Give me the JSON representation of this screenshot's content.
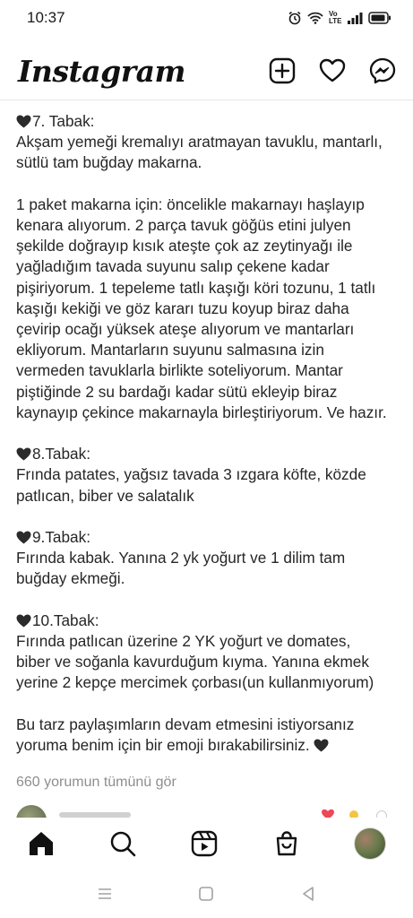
{
  "status": {
    "time": "10:37",
    "network_label": "Vo LTE"
  },
  "app": {
    "logo": "Instagram"
  },
  "caption": {
    "intro_lines": [
      "7. Tabak:",
      "Akşam yemeği kremalıyı aratmayan tavuklu, mantarlı,",
      "sütlü tam buğday makarna."
    ],
    "recipe_lines": [
      "1 paket makarna için: öncelikle makarnayı haşlayıp",
      "kenara alıyorum. 2 parça tavuk göğüs etini julyen",
      "şekilde doğrayıp kısık ateşte çok az zeytinyağı ile",
      "yağladığım tavada suyunu salıp çekene kadar",
      "pişiriyorum. 1 tepeleme tatlı kaşığı köri tozunu, 1 tatlı",
      "kaşığı kekiği ve göz kararı tuzu koyup biraz daha",
      "çevirip ocağı yüksek ateşe alıyorum ve mantarları",
      "ekliyorum. Mantarların suyunu salmasına izin",
      "vermeden tavuklarla birlikte soteliyorum. Mantar",
      "piştiğinde 2 su bardağı kadar sütü ekleyip biraz",
      "kaynayıp çekince makarnayla birleştiriyorum. Ve hazır."
    ],
    "tabak8_lines": [
      "8.Tabak:",
      "Frında patates, yağsız tavada 3 ızgara köfte, közde",
      "patlıcan, biber ve salatalık"
    ],
    "tabak9_lines": [
      "9.Tabak:",
      "Fırında kabak. Yanına 2 yk yoğurt ve 1 dilim tam",
      "buğday ekmeği."
    ],
    "tabak10_lines": [
      "10.Tabak:",
      "Fırında patlıcan üzerine 2 YK yoğurt ve domates,",
      "biber ve soğanla kavurduğum kıyma. Yanına ekmek",
      "yerine 2 kepçe mercimek çorbası(un kullanmıyorum)"
    ],
    "outro_lines": [
      "Bu tarz paylaşımların devam etmesini istiyorsanız",
      "yoruma benim için bir emoji bırakabilirsiniz."
    ]
  },
  "comments": {
    "view_all": "660 yorumun tümünü gör"
  },
  "colors": {
    "heart_emoji": "#2b2b2b",
    "muted_text": "#8e8e8e",
    "like_red": "#ed4956"
  }
}
